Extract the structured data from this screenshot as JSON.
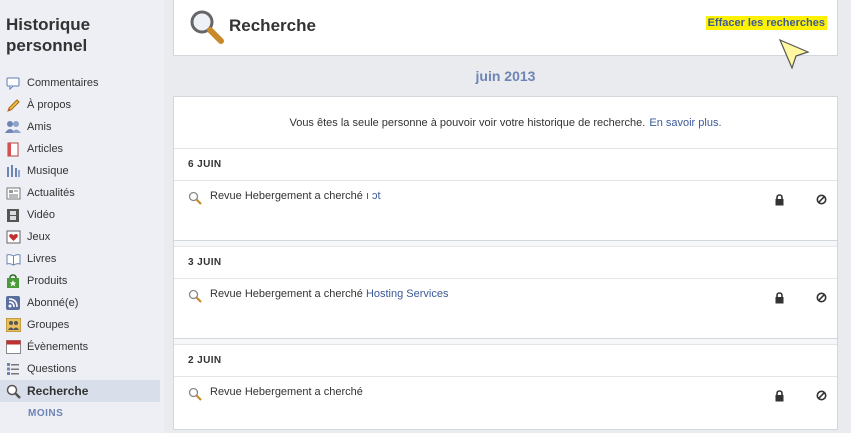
{
  "sidebar": {
    "title": "Historique personnel",
    "items": [
      {
        "label": "Commentaires",
        "icon": "comment-icon"
      },
      {
        "label": "À propos",
        "icon": "pencil-icon"
      },
      {
        "label": "Amis",
        "icon": "friends-icon"
      },
      {
        "label": "Articles",
        "icon": "document-icon"
      },
      {
        "label": "Musique",
        "icon": "music-icon"
      },
      {
        "label": "Actualités",
        "icon": "news-icon"
      },
      {
        "label": "Vidéo",
        "icon": "film-icon"
      },
      {
        "label": "Jeux",
        "icon": "games-icon"
      },
      {
        "label": "Livres",
        "icon": "book-icon"
      },
      {
        "label": "Produits",
        "icon": "products-icon"
      },
      {
        "label": "Abonné(e)",
        "icon": "rss-icon"
      },
      {
        "label": "Groupes",
        "icon": "groups-icon"
      },
      {
        "label": "Évènements",
        "icon": "calendar-icon"
      },
      {
        "label": "Questions",
        "icon": "questions-icon"
      },
      {
        "label": "Recherche",
        "icon": "search-icon",
        "active": true
      }
    ],
    "more_label": "MOINS"
  },
  "header": {
    "title": "Recherche",
    "clear_label": "Effacer les recherches"
  },
  "month_label": "juin 2013",
  "notice": {
    "text": "Vous êtes la seule personne à pouvoir voir votre historique de recherche.",
    "link": "En savoir plus."
  },
  "days": [
    {
      "label": "6 JUIN",
      "entry": {
        "text": "Revue Hebergement a cherché",
        "link": "ı             ɔt"
      }
    },
    {
      "label": "3 JUIN",
      "entry": {
        "text": "Revue Hebergement a cherché",
        "link": "  Hosting Services"
      }
    },
    {
      "label": "2 JUIN",
      "entry": {
        "text": "Revue Hebergement a cherché",
        "link": ""
      }
    }
  ],
  "colors": {
    "link": "#3b5998",
    "month": "#6d84b4",
    "highlight": "#fff200",
    "background": "#e9ebee"
  }
}
